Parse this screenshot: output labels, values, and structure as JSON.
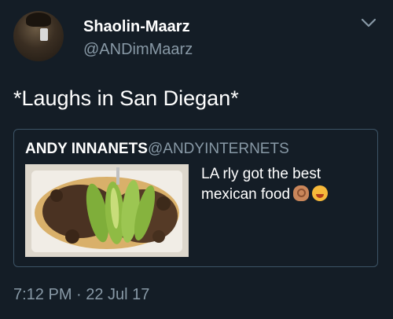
{
  "author": {
    "display_name": "Shaolin-Maarz",
    "handle": "@ANDimMaarz"
  },
  "tweet": {
    "text": "*Laughs in San Diegan*",
    "timestamp": "7:12 PM · 22 Jul 17"
  },
  "quoted_tweet": {
    "display_name": "ANDY INNANETS",
    "handle": "@ANDYINTERNETS",
    "text": "LA rly got the best mexican food",
    "emojis": [
      "ok-hand-medium-skin-tone",
      "drooling-face"
    ]
  },
  "icons": {
    "menu": "chevron-down-icon"
  },
  "colors": {
    "background": "#141d26",
    "secondary_text": "#8899a6",
    "border": "#3d5466"
  }
}
